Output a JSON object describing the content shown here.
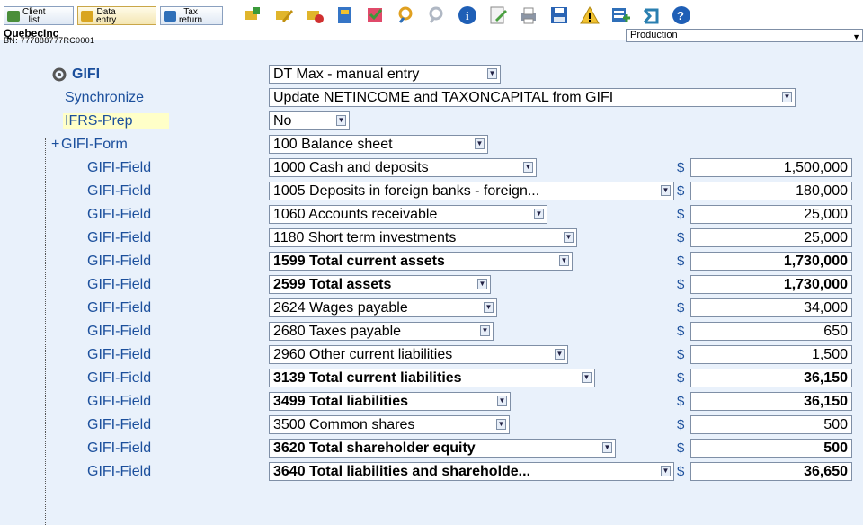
{
  "toolbar": {
    "nav": [
      {
        "label": "Client\nlist",
        "icon": "client-list-icon"
      },
      {
        "label": "Data\nentry",
        "icon": "data-entry-icon"
      },
      {
        "label": "Tax\nreturn",
        "icon": "tax-return-icon"
      }
    ],
    "icons": [
      "add-form-icon",
      "edit-form-icon",
      "delete-form-icon",
      "journal-icon",
      "checklist-icon",
      "search-icon",
      "search-next-icon",
      "info-icon",
      "review-icon",
      "print-icon",
      "save-icon",
      "warning-icon",
      "add-row-icon",
      "back-icon",
      "help-icon"
    ]
  },
  "header": {
    "company": "QuebecInc",
    "bn": "BN: 777888777RC0001",
    "mode": "Production"
  },
  "tree": {
    "gifi": {
      "label": "GIFI",
      "value": "DT Max - manual entry"
    },
    "sync": {
      "label": "Synchronize",
      "value": "Update NETINCOME and TAXONCAPITAL from GIFI"
    },
    "ifrs": {
      "label": "IFRS-Prep",
      "value": "No"
    },
    "form": {
      "label": "GIFI-Form",
      "value": "100  Balance sheet"
    },
    "fields": [
      {
        "label": "GIFI-Field",
        "code": "1000  Cash and deposits",
        "amount": "1,500,000",
        "bold": false
      },
      {
        "label": "GIFI-Field",
        "code": "1005  Deposits in foreign banks - foreign...",
        "amount": "180,000",
        "bold": false
      },
      {
        "label": "GIFI-Field",
        "code": "1060  Accounts receivable",
        "amount": "25,000",
        "bold": false
      },
      {
        "label": "GIFI-Field",
        "code": "1180  Short term investments",
        "amount": "25,000",
        "bold": false
      },
      {
        "label": "GIFI-Field",
        "code": "1599  Total current assets",
        "amount": "1,730,000",
        "bold": true
      },
      {
        "label": "GIFI-Field",
        "code": "2599  Total assets",
        "amount": "1,730,000",
        "bold": true
      },
      {
        "label": "GIFI-Field",
        "code": "2624  Wages payable",
        "amount": "34,000",
        "bold": false
      },
      {
        "label": "GIFI-Field",
        "code": "2680  Taxes payable",
        "amount": "650",
        "bold": false
      },
      {
        "label": "GIFI-Field",
        "code": "2960  Other current liabilities",
        "amount": "1,500",
        "bold": false
      },
      {
        "label": "GIFI-Field",
        "code": "3139  Total current liabilities",
        "amount": "36,150",
        "bold": true
      },
      {
        "label": "GIFI-Field",
        "code": "3499  Total liabilities",
        "amount": "36,150",
        "bold": true
      },
      {
        "label": "GIFI-Field",
        "code": "3500  Common shares",
        "amount": "500",
        "bold": false
      },
      {
        "label": "GIFI-Field",
        "code": "3620  Total shareholder equity",
        "amount": "500",
        "bold": true
      },
      {
        "label": "GIFI-Field",
        "code": "3640  Total liabilities and shareholde...",
        "amount": "36,650",
        "bold": true
      }
    ],
    "currency": "$"
  }
}
